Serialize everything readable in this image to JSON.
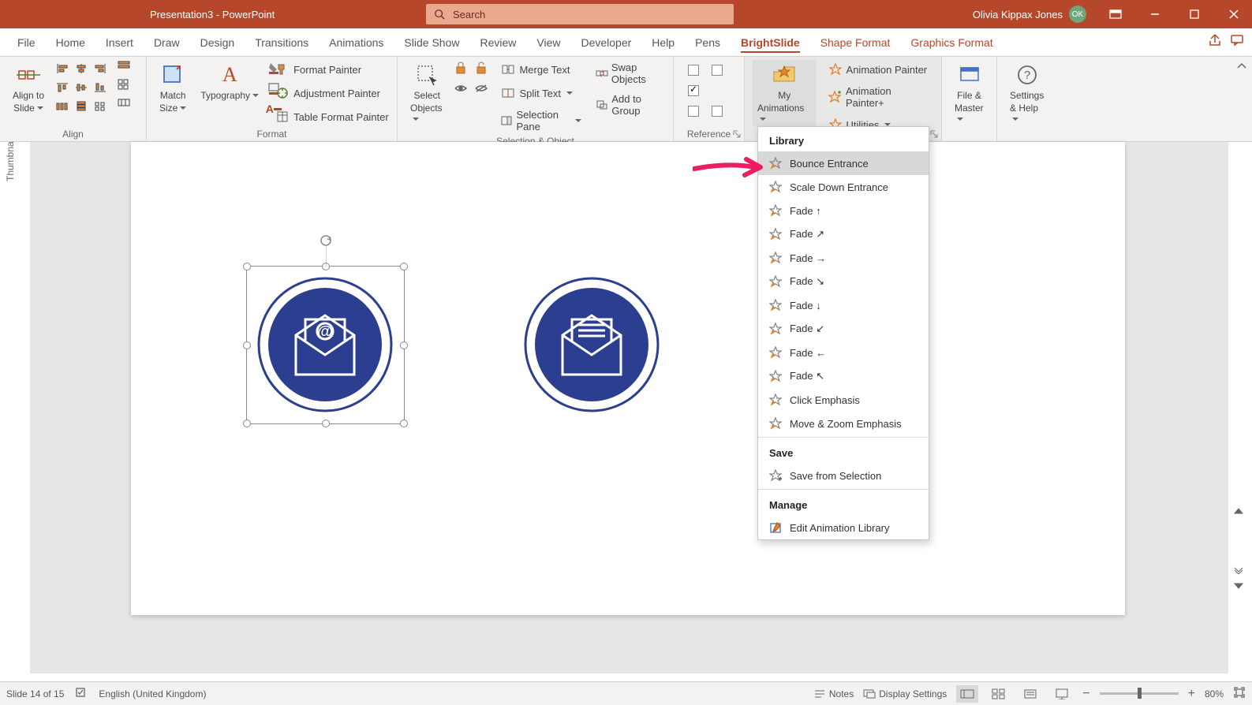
{
  "titlebar": {
    "title": "Presentation3  -  PowerPoint",
    "search_placeholder": "Search",
    "user_name": "Olivia Kippax Jones",
    "user_initials": "OK"
  },
  "tabs": {
    "file": "File",
    "home": "Home",
    "insert": "Insert",
    "draw": "Draw",
    "design": "Design",
    "transitions": "Transitions",
    "animations": "Animations",
    "slideshow": "Slide Show",
    "review": "Review",
    "view": "View",
    "developer": "Developer",
    "help": "Help",
    "pens": "Pens",
    "brightslide": "BrightSlide",
    "shape_format": "Shape Format",
    "graphics_format": "Graphics Format"
  },
  "ribbon": {
    "align": {
      "main_label": "Align to",
      "main_sub": "Slide",
      "group": "Align"
    },
    "format": {
      "match_label": "Match",
      "match_sub": "Size",
      "typo_label": "Typography",
      "format_painter": "Format Painter",
      "adjustment_painter": "Adjustment Painter",
      "table_format_painter": "Table Format Painter",
      "group": "Format"
    },
    "selection": {
      "select_label": "Select",
      "select_sub": "Objects",
      "merge_text": "Merge Text",
      "swap_objects": "Swap Objects",
      "split_text": "Split Text",
      "add_to_group": "Add to Group",
      "selection_pane": "Selection Pane",
      "group": "Selection & Object"
    },
    "reference": {
      "group": "Reference"
    },
    "animations": {
      "my_label": "My",
      "my_sub": "Animations",
      "animation_painter": "Animation Painter",
      "animation_painter_plus": "Animation Painter+",
      "utilities": "Utilities"
    },
    "filemaster": {
      "label1": "File &",
      "label2": "Master"
    },
    "settings": {
      "label1": "Settings",
      "label2": "& Help"
    }
  },
  "dropdown": {
    "library_header": "Library",
    "items": [
      "Bounce Entrance",
      "Scale Down Entrance",
      "Fade ↑",
      "Fade ↗",
      "Fade →",
      "Fade ↘",
      "Fade ↓",
      "Fade ↙",
      "Fade ←",
      "Fade ↖",
      "Click Emphasis",
      "Move & Zoom Emphasis"
    ],
    "save_header": "Save",
    "save_item": "Save from Selection",
    "manage_header": "Manage",
    "manage_item": "Edit Animation Library"
  },
  "thumbnails_label": "Thumbna",
  "statusbar": {
    "slide_info": "Slide 14 of 15",
    "language": "English (United Kingdom)",
    "notes": "Notes",
    "display_settings": "Display Settings",
    "zoom": "80%"
  }
}
